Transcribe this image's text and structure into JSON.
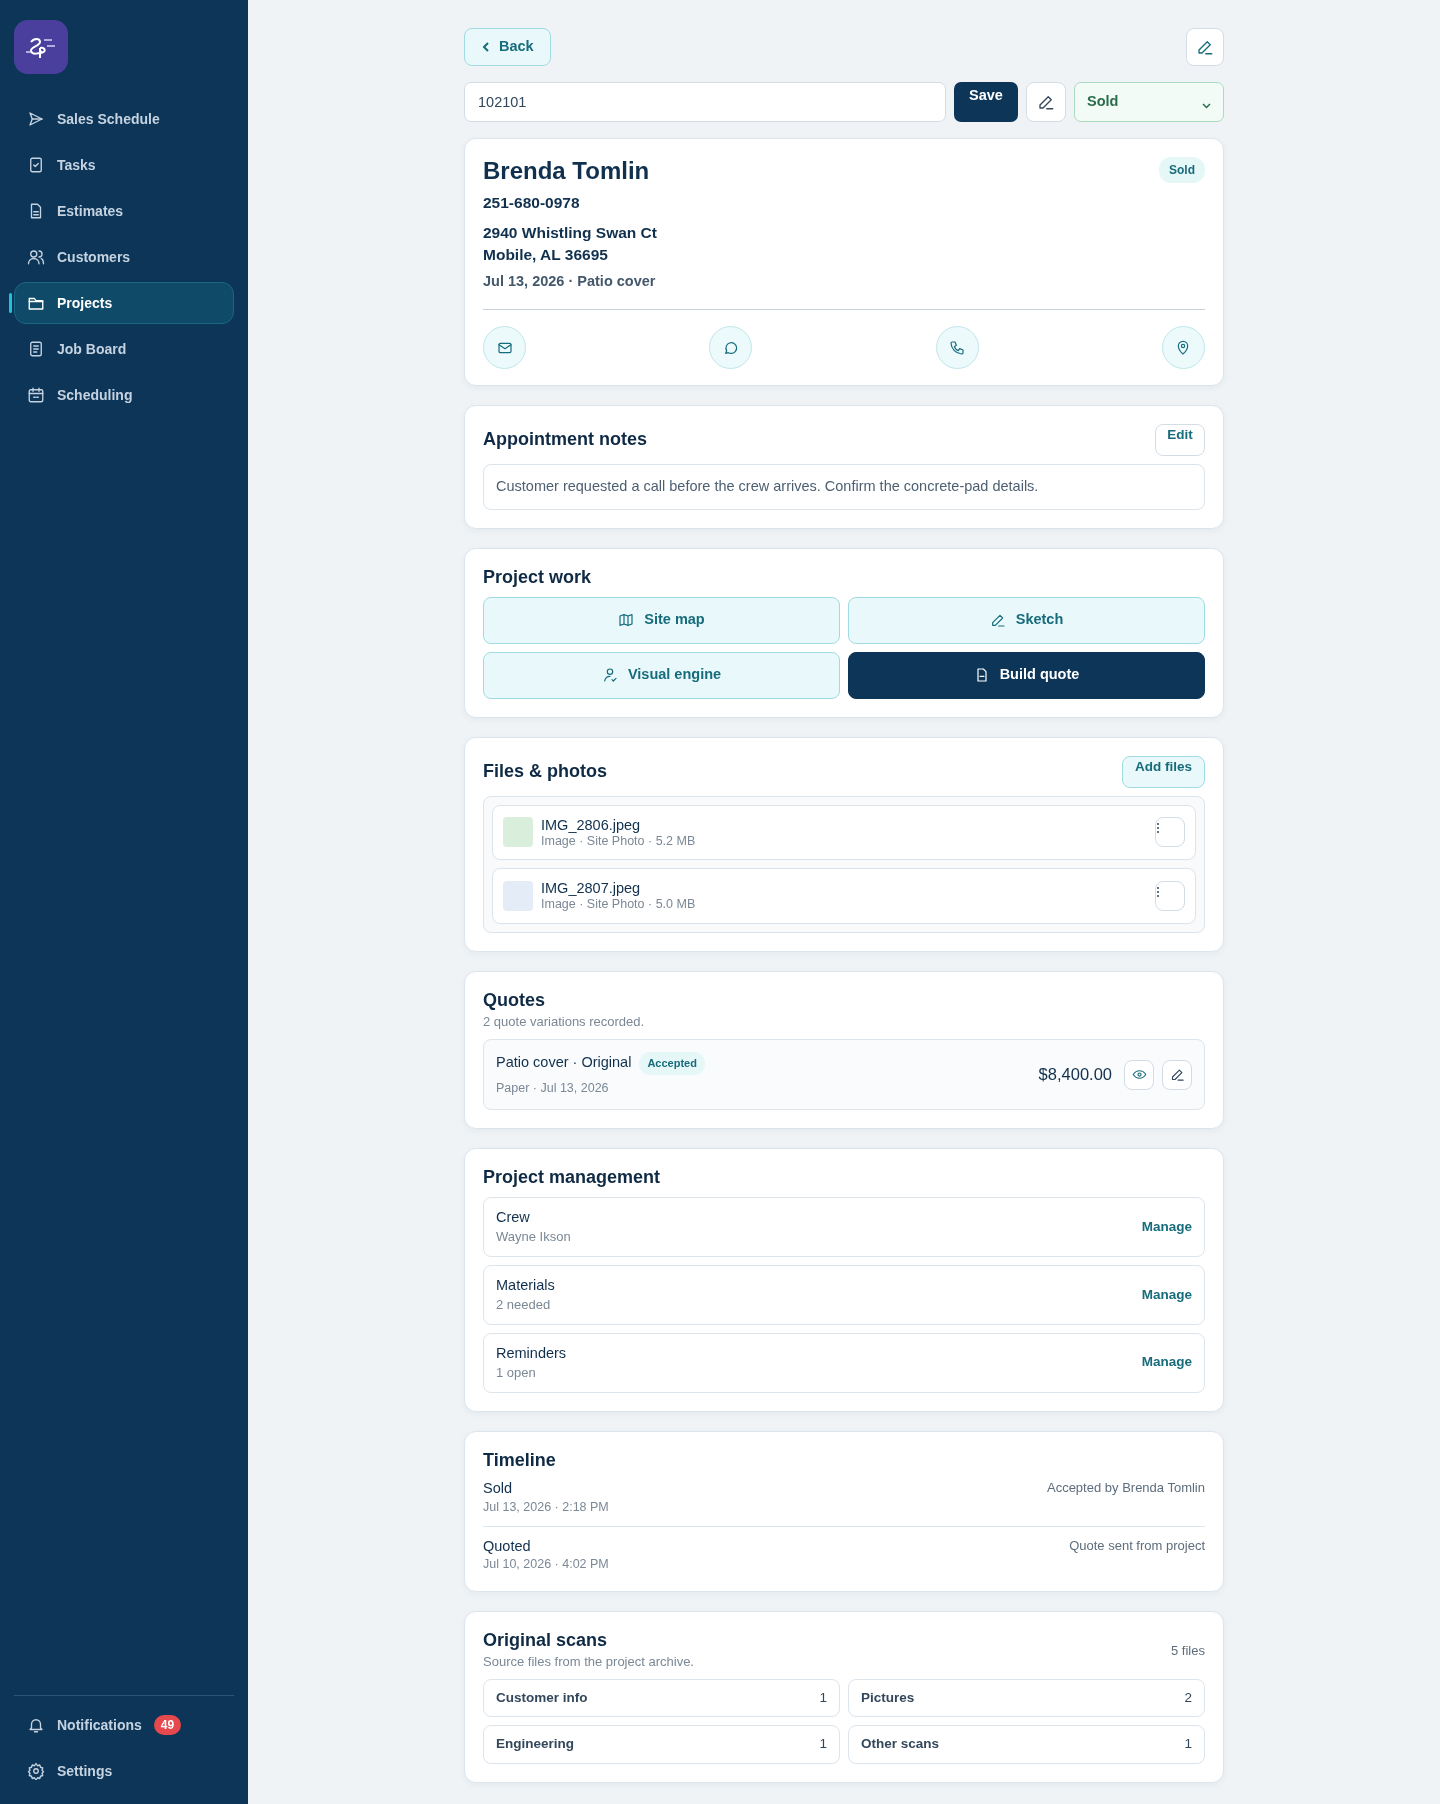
{
  "sidebar": {
    "items": [
      {
        "label": "Sales Schedule",
        "selected": false
      },
      {
        "label": "Tasks",
        "selected": false
      },
      {
        "label": "Estimates",
        "selected": false
      },
      {
        "label": "Customers",
        "selected": false
      },
      {
        "label": "Projects",
        "selected": true
      },
      {
        "label": "Job Board",
        "selected": false
      },
      {
        "label": "Scheduling",
        "selected": false
      }
    ],
    "footer": [
      {
        "label": "Notifications",
        "badge": "49"
      },
      {
        "label": "Settings"
      }
    ]
  },
  "toolbar": {
    "back": "Back",
    "project_number": "102101",
    "save": "Save",
    "status": "Sold"
  },
  "customer": {
    "name": "Brenda Tomlin",
    "badge": "Sold",
    "phone": "251-680-0978",
    "address": [
      "2940 Whistling Swan Ct",
      "Mobile, AL 36695"
    ],
    "meta": "Jul 13, 2026 · Patio cover"
  },
  "notes": {
    "title": "Appointment notes",
    "edit": "Edit",
    "text": "Customer requested a call before the crew arrives. Confirm the concrete-pad details."
  },
  "project_work": {
    "title": "Project work",
    "buttons": [
      {
        "label": "Site map",
        "primary": false
      },
      {
        "label": "Sketch",
        "primary": false
      },
      {
        "label": "Visual engine",
        "primary": false
      },
      {
        "label": "Build quote",
        "primary": true
      }
    ]
  },
  "files": {
    "title": "Files & photos",
    "add": "Add files",
    "items": [
      {
        "name": "IMG_2806.jpeg",
        "meta": "Image · Site Photo · 5.2 MB",
        "color": "#d9eedb"
      },
      {
        "name": "IMG_2807.jpeg",
        "meta": "Image · Site Photo · 5.0 MB",
        "color": "#e4ecf8"
      }
    ]
  },
  "quotes": {
    "title": "Quotes",
    "subtitle": "2 quote variations recorded.",
    "items": [
      {
        "name": "Patio cover · Original",
        "badge": "Accepted",
        "meta": "Paper · Jul 13, 2026",
        "amount": "$8,400.00"
      }
    ]
  },
  "management": {
    "title": "Project management",
    "items": [
      {
        "label": "Crew",
        "detail": "Wayne Ikson",
        "action": "Manage"
      },
      {
        "label": "Materials",
        "detail": "2 needed",
        "action": "Manage"
      },
      {
        "label": "Reminders",
        "detail": "1 open",
        "action": "Manage"
      }
    ]
  },
  "timeline": {
    "title": "Timeline",
    "items": [
      {
        "status": "Sold",
        "date": "Jul 13, 2026 · 2:18 PM",
        "note": "Accepted by Brenda Tomlin"
      },
      {
        "status": "Quoted",
        "date": "Jul 10, 2026 · 4:02 PM",
        "note": "Quote sent from project"
      }
    ]
  },
  "scans": {
    "title": "Original scans",
    "subtitle": "Source files from the project archive.",
    "count": "5 files",
    "items": [
      {
        "label": "Customer info",
        "count": "1"
      },
      {
        "label": "Pictures",
        "count": "2"
      },
      {
        "label": "Engineering",
        "count": "1"
      },
      {
        "label": "Other scans",
        "count": "1"
      }
    ]
  }
}
